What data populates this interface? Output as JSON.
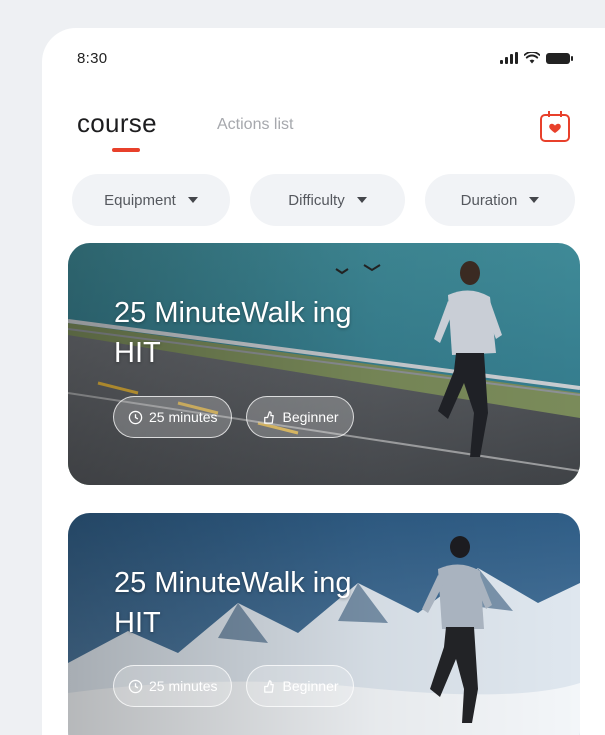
{
  "status": {
    "time": "8:30"
  },
  "tabs": {
    "course": "course",
    "actions": "Actions list"
  },
  "filters": [
    {
      "label": "Equipment"
    },
    {
      "label": "Difficulty"
    },
    {
      "label": "Duration"
    }
  ],
  "courses": [
    {
      "title": "25 MinuteWalk ing HIT",
      "duration": "25 minutes",
      "level": "Beginner"
    },
    {
      "title": "25 MinuteWalk ing HIT",
      "duration": "25 minutes",
      "level": "Beginner"
    }
  ],
  "colors": {
    "accent": "#e8402b",
    "pill_bg": "#f1f3f6",
    "page_bg": "#eef0f3"
  },
  "icons": [
    "signal-icon",
    "wifi-icon",
    "battery-icon",
    "calendar-icon",
    "chevron-down-icon",
    "clock-icon",
    "level-icon"
  ]
}
